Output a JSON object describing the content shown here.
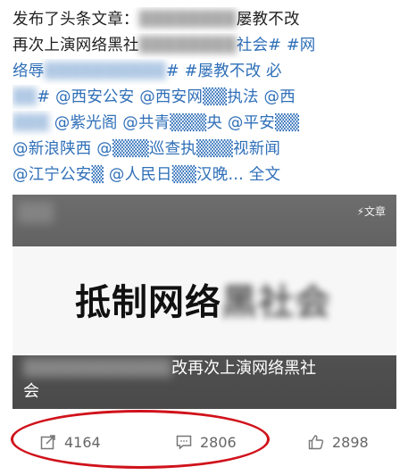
{
  "post": {
    "lines": [
      {
        "a": "发布了头条文章：",
        "b": "▒▒▒▒▒▒▒▒",
        "c": "屡教不改"
      },
      {
        "a": "再次上演网络黑社",
        "b": "▒▒▒▒▒▒▒▒",
        "c": "社会# #网"
      },
      {
        "a": "络辱",
        "b": "▒▒▒▒▒▒▒▒▒▒",
        "c": "# #屡教不改 必"
      },
      {
        "a": "",
        "b": "▒▒",
        "c": "# @西安公安 @西安网▒▒执法 @西"
      },
      {
        "a": "",
        "b": "▒▒▒",
        "c": " @紫光阁 @共青▒▒▒央 @平安▒▒"
      },
      {
        "a": "",
        "b": "",
        "c": "@新浪陕西 @▒▒▒巡查执▒▒▒视新闻"
      },
      {
        "a": "",
        "b": "",
        "c": "@江宁公安▒ @人民日▒▒汉晚… 全文"
      }
    ]
  },
  "article": {
    "badge": "⚡文章",
    "banner_title": "抵制网络",
    "banner_title_blur": "黑社会",
    "caption_blur": "▒▒▒▒▒▒▒▒▒▒▒▒",
    "caption": "改再次上演网络黑社",
    "caption_line2": "会"
  },
  "actions": {
    "share_count": "4164",
    "comment_count": "2806",
    "like_count": "2898"
  },
  "colors": {
    "highlight": "#d0121b",
    "tag": "#2f6fb8"
  }
}
